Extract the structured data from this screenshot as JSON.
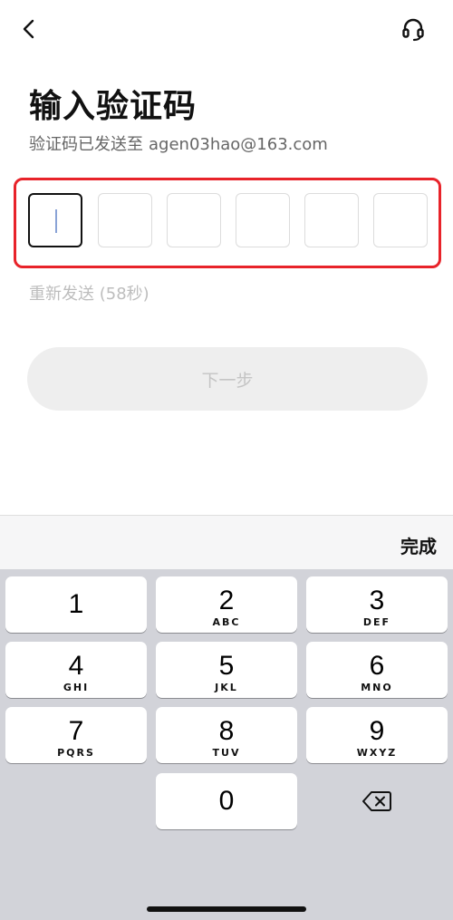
{
  "header": {
    "back_icon": "chevron-left-icon",
    "support_icon": "headset-icon"
  },
  "title": "输入验证码",
  "subtitle": {
    "prefix": "验证码已发送至",
    "email": "agen03hao@163.com"
  },
  "code": {
    "length": 6,
    "values": [
      "",
      "",
      "",
      "",
      "",
      ""
    ],
    "active_index": 0
  },
  "resend_text": "重新发送 (58秒)",
  "next_button_label": "下一步",
  "keyboard": {
    "done_label": "完成",
    "keys": [
      {
        "digit": "1",
        "letters": ""
      },
      {
        "digit": "2",
        "letters": "ABC"
      },
      {
        "digit": "3",
        "letters": "DEF"
      },
      {
        "digit": "4",
        "letters": "GHI"
      },
      {
        "digit": "5",
        "letters": "JKL"
      },
      {
        "digit": "6",
        "letters": "MNO"
      },
      {
        "digit": "7",
        "letters": "PQRS"
      },
      {
        "digit": "8",
        "letters": "TUV"
      },
      {
        "digit": "9",
        "letters": "WXYZ"
      },
      {
        "digit": "0",
        "letters": ""
      }
    ],
    "delete_icon": "backspace-icon"
  },
  "colors": {
    "highlight_border": "#e8232a",
    "cursor": "#8aa3d6",
    "disabled_text": "#c4c4c4"
  }
}
